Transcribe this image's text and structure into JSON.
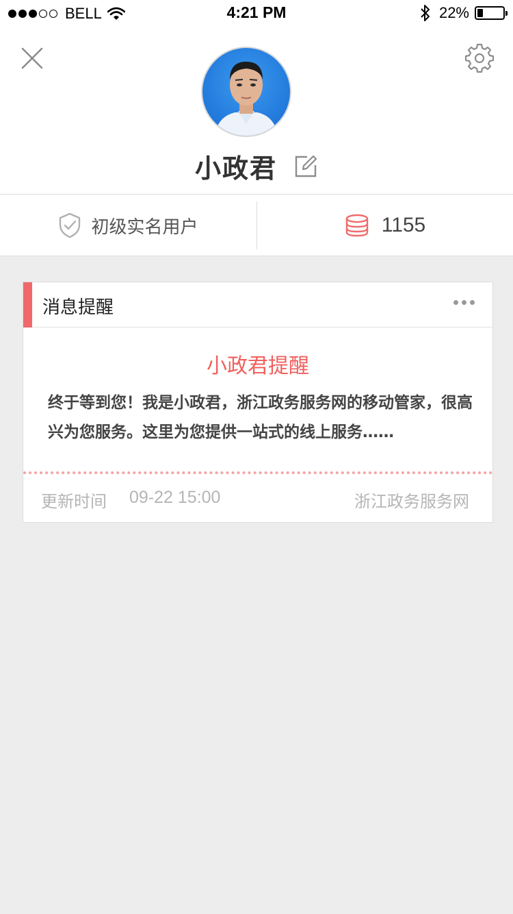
{
  "status_bar": {
    "carrier": "BELL",
    "signal_strength": 3,
    "signal_max": 5,
    "time": "4:21 PM",
    "battery_text": "22%",
    "battery_level": 0.22
  },
  "profile": {
    "username": "小政君"
  },
  "stats": {
    "verification_label": "初级实名用户",
    "points_value": "1155"
  },
  "card": {
    "header_title": "消息提醒",
    "message_title": "小政君提醒",
    "message_body": "终于等到您！我是小政君，浙江政务服务网的移动管家，很高兴为您服务。这里为您提供一站式的线上服务……",
    "update_label": "更新时间",
    "update_time": "09-22 15:00",
    "source": "浙江政务服务网"
  },
  "colors": {
    "accent": "#f0686a",
    "message_title": "#f0605f",
    "background": "#ededed",
    "icon_gray": "#8c8c8c"
  },
  "icons": [
    "close-icon",
    "settings-icon",
    "edit-icon",
    "shield-check-icon",
    "coins-icon",
    "more-icon",
    "wifi-icon",
    "bluetooth-icon"
  ]
}
